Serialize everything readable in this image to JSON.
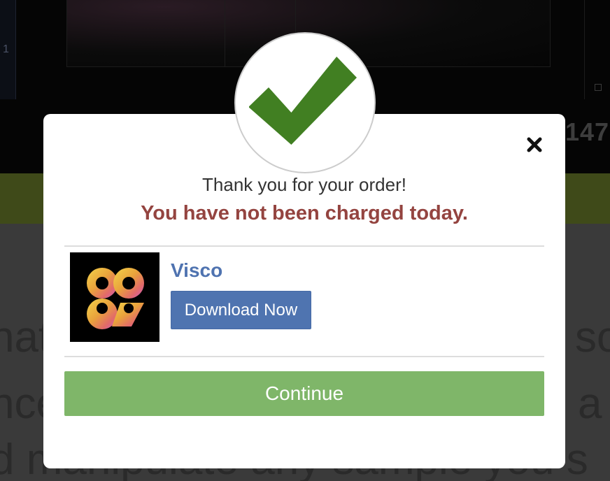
{
  "modal": {
    "thanks_text": "Thank you for your order!",
    "charge_notice": "You have not been charged today.",
    "product": {
      "name": "Visco",
      "download_label": "Download Now",
      "logo_icon": "visco-app-logo"
    },
    "continue_label": "Continue",
    "success_icon": "checkmark-icon",
    "close_icon": "close-icon"
  },
  "background": {
    "side_mark": "1",
    "counter_text": "147",
    "text_lines": [
      "nat",
      "nce",
      "d manipulate any sample you s"
    ],
    "text_right": [
      "so",
      "a"
    ]
  },
  "colors": {
    "notice_red": "#944440",
    "product_blue": "#4f73b0",
    "download_blue": "#4f74b0",
    "continue_green": "#7fb669",
    "check_green": "#417f22"
  }
}
